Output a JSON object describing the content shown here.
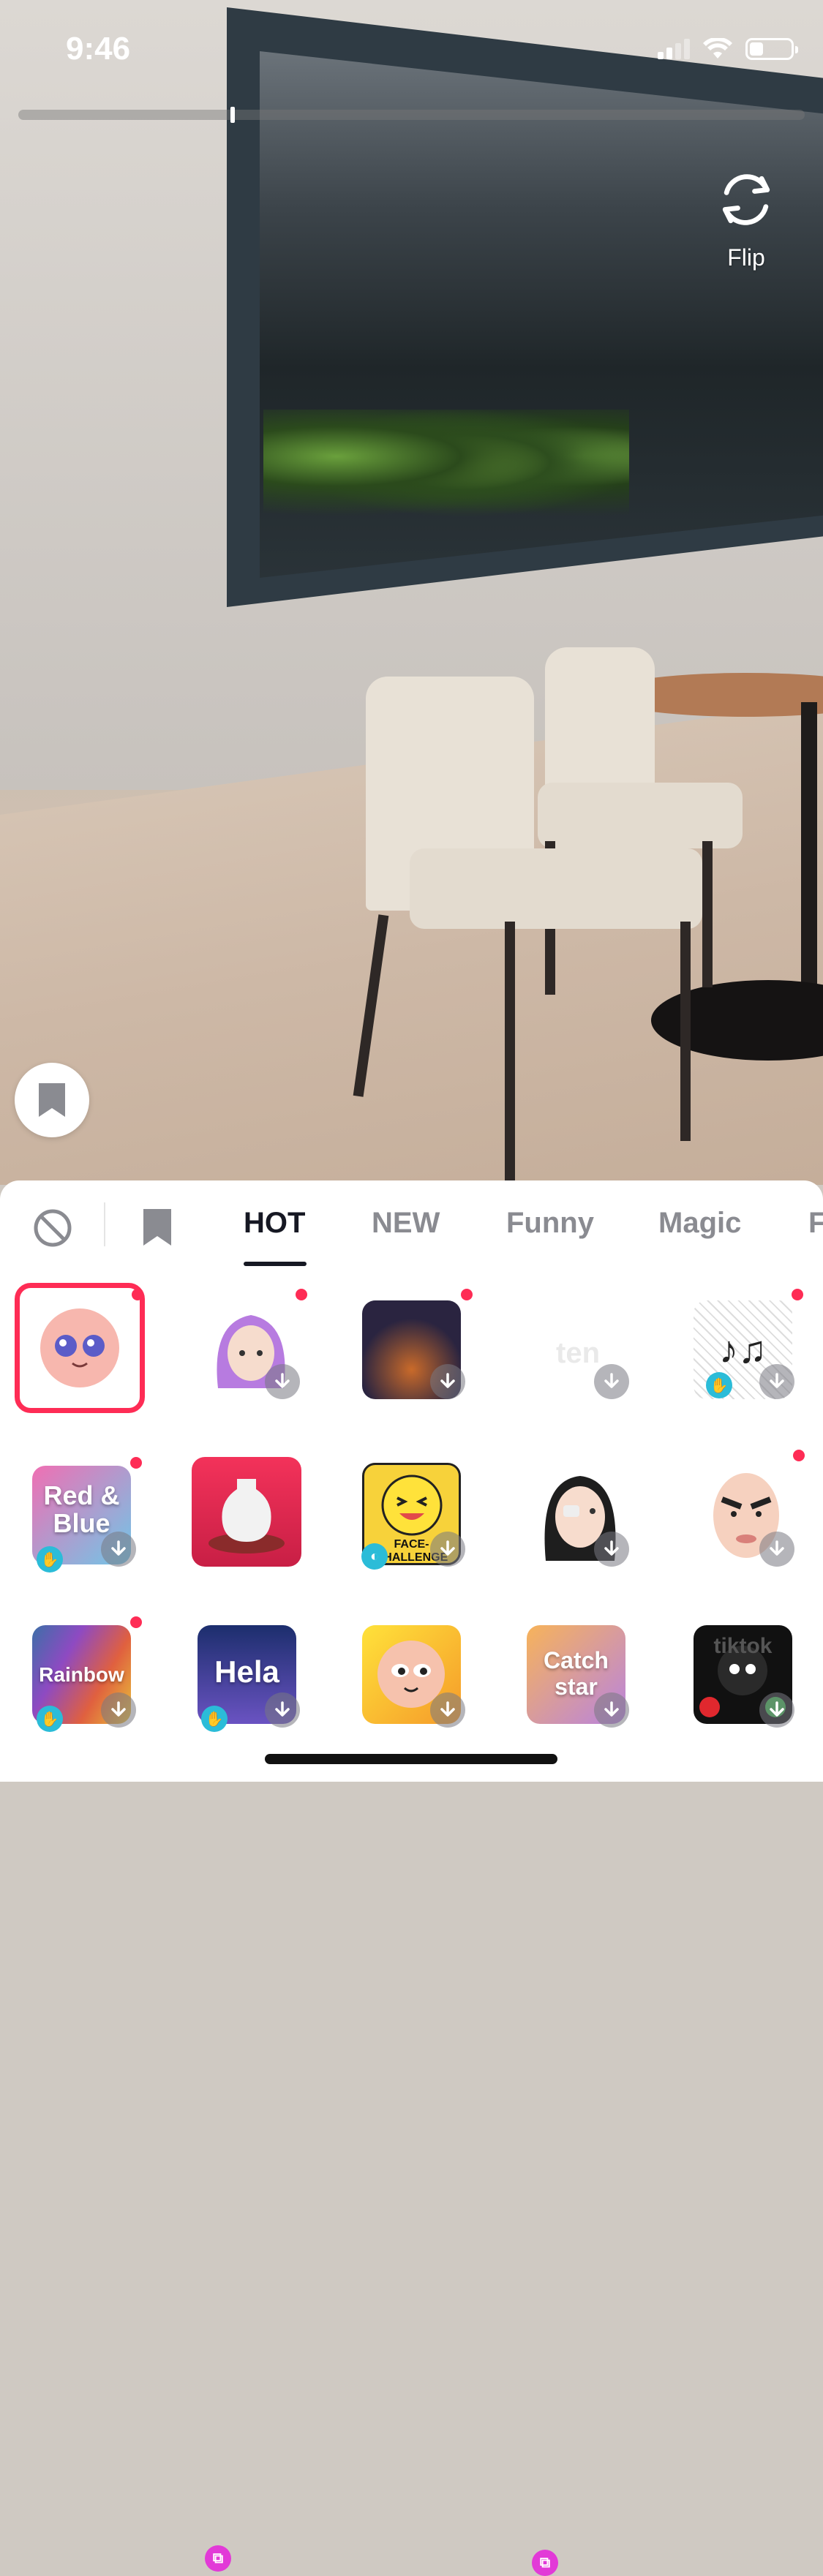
{
  "status_bar": {
    "time": "9:46",
    "signal_bars": 2,
    "battery_level": 0.3
  },
  "recording": {
    "progress": 0.27
  },
  "camera_controls": {
    "flip_label": "Flip"
  },
  "effects_panel": {
    "tabs": [
      {
        "label": "HOT",
        "active": true
      },
      {
        "label": "NEW",
        "active": false
      },
      {
        "label": "Funny",
        "active": false
      },
      {
        "label": "Magic",
        "active": false
      },
      {
        "label": "F",
        "active": false
      }
    ],
    "tiles": [
      {
        "name": "kawaii-face",
        "text": "",
        "selected": true
      },
      {
        "name": "purple-hair-avatar",
        "text": ""
      },
      {
        "name": "sky-lanterns",
        "text": ""
      },
      {
        "name": "ten-sticker",
        "text": "ten"
      },
      {
        "name": "music-notes",
        "text": ""
      },
      {
        "name": "red-and-blue",
        "text": "Red & Blue"
      },
      {
        "name": "pottery-vase",
        "text": ""
      },
      {
        "name": "face-challenge",
        "text": "FACE-CHALLENGE"
      },
      {
        "name": "eyepatch-girl",
        "text": ""
      },
      {
        "name": "angry-baby-face",
        "text": ""
      },
      {
        "name": "rainbow",
        "text": "Rainbow"
      },
      {
        "name": "hela",
        "text": "Hela"
      },
      {
        "name": "yellow-face",
        "text": ""
      },
      {
        "name": "catch-star",
        "text": "Catch star"
      },
      {
        "name": "tiktok-call",
        "text": "tiktok"
      }
    ]
  },
  "colors": {
    "accent": "#fe2c55",
    "text_active": "#161823",
    "text_inactive": "#8a8b91"
  }
}
